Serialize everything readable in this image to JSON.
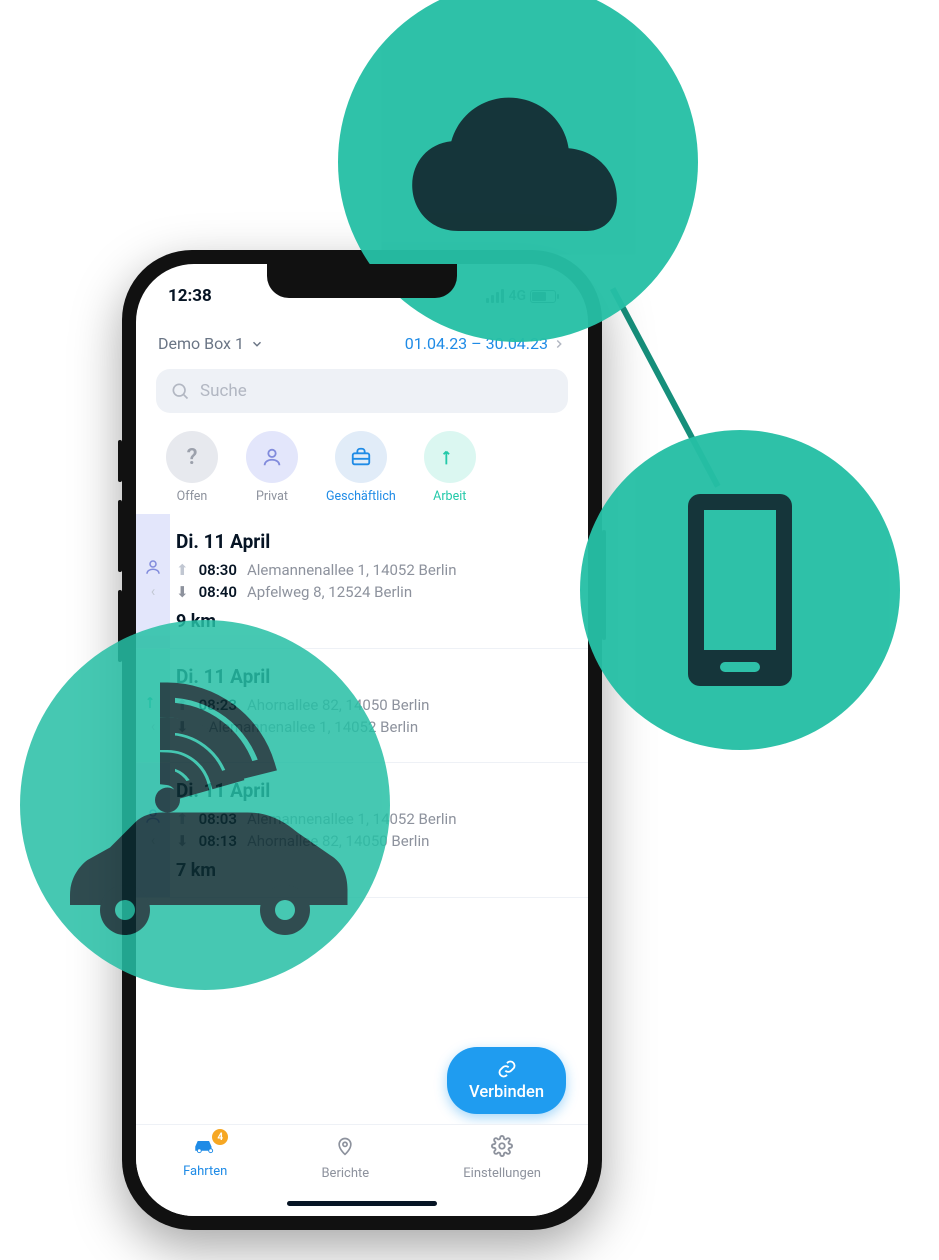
{
  "statusbar": {
    "time": "12:38",
    "network": "4G"
  },
  "header": {
    "box_label": "Demo Box 1",
    "date_range": "01.04.23 – 30.04.23"
  },
  "search": {
    "placeholder": "Suche"
  },
  "chips": {
    "offen": {
      "label": "Offen",
      "glyph": "?"
    },
    "privat": {
      "label": "Privat"
    },
    "business": {
      "label": "Geschäftlich"
    },
    "work": {
      "label": "Arbeit"
    }
  },
  "trips": [
    {
      "kind": "privat",
      "title": "Di. 11 April",
      "rows": [
        {
          "time": "08:30",
          "addr": "Alemannenallee 1, 14052 Berlin"
        },
        {
          "time": "08:40",
          "addr": "Apfelweg 8, 12524 Berlin"
        }
      ],
      "km": "9 km"
    },
    {
      "kind": "work",
      "title": "Di. 11 April",
      "rows": [
        {
          "time": "08:23",
          "addr": "Ahornallee 82, 14050 Berlin"
        },
        {
          "time": "",
          "addr": "Alemannenallee 1, 14052 Berlin"
        }
      ],
      "km": ""
    },
    {
      "kind": "privat",
      "title": "Di. 11 April",
      "rows": [
        {
          "time": "08:03",
          "addr": "Alemannenallee 1, 14052 Berlin"
        },
        {
          "time": "08:13",
          "addr": "Ahornallee 82, 14050 Berlin"
        }
      ],
      "km": "7 km"
    }
  ],
  "fab": {
    "label": "Verbinden"
  },
  "tabs": {
    "trips": {
      "label": "Fahrten",
      "badge": "4"
    },
    "reports": {
      "label": "Berichte"
    },
    "settings": {
      "label": "Einstellungen"
    }
  }
}
